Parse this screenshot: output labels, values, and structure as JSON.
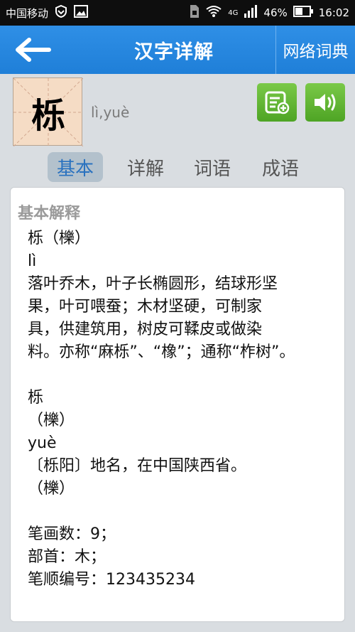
{
  "status_bar": {
    "carrier": "中国移动",
    "network": "4G",
    "battery": "46%",
    "time": "16:02"
  },
  "header": {
    "title": "汉字详解",
    "right_button": "网络词典"
  },
  "character": {
    "glyph": "栎",
    "pinyin": "lì,yuè"
  },
  "tabs": [
    {
      "label": "基本",
      "active": true
    },
    {
      "label": "详解",
      "active": false
    },
    {
      "label": "词语",
      "active": false
    },
    {
      "label": "成语",
      "active": false
    }
  ],
  "content": {
    "section_title": "基本解释",
    "lines": [
      "栎（櫟）",
      "lì",
      "落叶乔木，叶子长椭圆形，结球形坚",
      "果，叶可喂蚕；木材坚硬，可制家",
      "具，供建筑用，树皮可鞣皮或做染",
      "料。亦称“麻栎”、“橡”；通称“柞树”。",
      "",
      "栎",
      "（櫟）",
      "yuè",
      "〔栎阳〕地名，在中国陕西省。",
      "（櫟）",
      "",
      "笔画数：9；",
      "部首：木；",
      "笔顺编号：123435234"
    ]
  },
  "colors": {
    "header_blue": "#1f7fd8",
    "button_green": "#5fb233",
    "active_tab_text": "#2a72bf"
  }
}
